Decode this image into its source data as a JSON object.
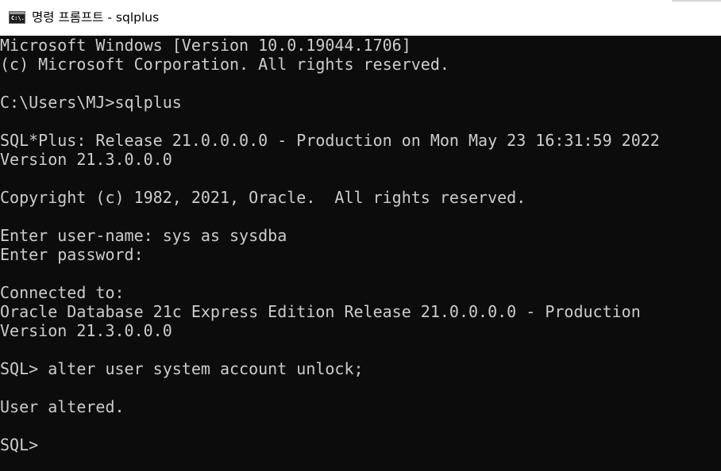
{
  "window": {
    "title": "명령 프롬프트 - sqlplus",
    "icon_name": "cmd-icon",
    "icon_glyph": "C:\\."
  },
  "console": {
    "lines": [
      "Microsoft Windows [Version 10.0.19044.1706]",
      "(c) Microsoft Corporation. All rights reserved.",
      "",
      "C:\\Users\\MJ>sqlplus",
      "",
      "SQL*Plus: Release 21.0.0.0.0 - Production on Mon May 23 16:31:59 2022",
      "Version 21.3.0.0.0",
      "",
      "Copyright (c) 1982, 2021, Oracle.  All rights reserved.",
      "",
      "Enter user-name: sys as sysdba",
      "Enter password:",
      "",
      "Connected to:",
      "Oracle Database 21c Express Edition Release 21.0.0.0.0 - Production",
      "Version 21.3.0.0.0",
      "",
      "SQL> alter user system account unlock;",
      "",
      "User altered.",
      "",
      "SQL>"
    ]
  },
  "colors": {
    "console_background": "#0c0c0c",
    "console_text": "#cccccc",
    "titlebar_background": "#ffffff"
  }
}
